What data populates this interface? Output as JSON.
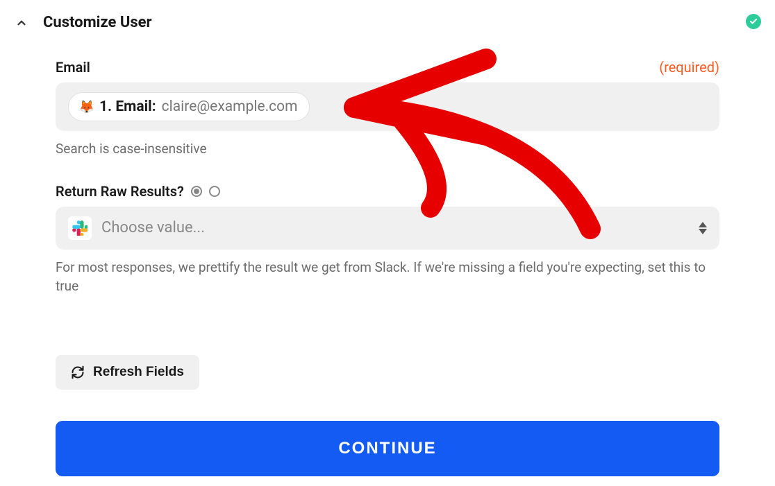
{
  "header": {
    "title": "Customize User"
  },
  "email_field": {
    "label": "Email",
    "required_text": "(required)",
    "pill_prefix": "1. Email:",
    "pill_value": "claire@example.com",
    "helper": "Search is case-insensitive",
    "pill_icon_emoji": "🦊"
  },
  "raw_field": {
    "label": "Return Raw Results?",
    "placeholder": "Choose value...",
    "helper": "For most responses, we prettify the result we get from Slack. If we're missing a field you're expecting, set this to true"
  },
  "buttons": {
    "refresh": "Refresh Fields",
    "continue": "CONTINUE"
  },
  "colors": {
    "primary": "#135bf2",
    "required": "#ff5a1f",
    "success": "#2ecc9b"
  }
}
